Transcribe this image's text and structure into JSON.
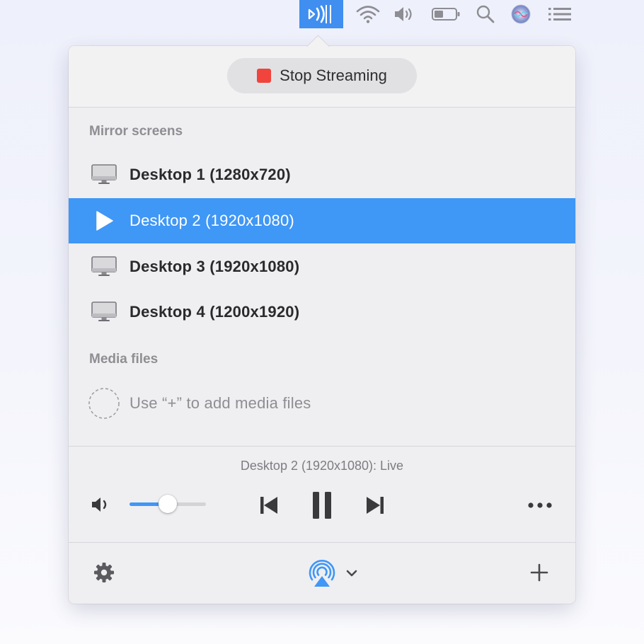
{
  "menubar": {
    "icons": [
      "airplay-stream-icon",
      "wifi-icon",
      "volume-icon",
      "battery-icon",
      "search-icon",
      "siri-icon",
      "list-icon"
    ],
    "active_color": "#3f8ef0"
  },
  "popover": {
    "stop_button": {
      "label": "Stop Streaming",
      "icon": "stop-square-icon",
      "icon_color": "#f0443c"
    },
    "mirror_section": {
      "title": "Mirror screens",
      "items": [
        {
          "label": "Desktop 1 (1280x720)",
          "icon": "monitor-icon",
          "selected": false
        },
        {
          "label": "Desktop 2 (1920x1080)",
          "icon": "play-icon",
          "selected": true
        },
        {
          "label": "Desktop 3 (1920x1080)",
          "icon": "monitor-icon",
          "selected": false
        },
        {
          "label": "Desktop 4 (1200x1920)",
          "icon": "monitor-icon",
          "selected": false
        }
      ]
    },
    "media_section": {
      "title": "Media files",
      "hint": "Use “+” to add media files",
      "hint_icon": "dashed-circle-icon"
    },
    "player": {
      "now_playing": "Desktop 2 (1920x1080): Live",
      "volume_fraction": 0.5,
      "controls": [
        "previous-track-icon",
        "pause-icon",
        "next-track-icon",
        "more-icon"
      ]
    },
    "footer": {
      "icons": [
        "gear-icon",
        "airplay-icon",
        "chevron-down-icon",
        "plus-icon"
      ],
      "accent_color": "#3f97f6"
    },
    "selection_color": "#3f97f6"
  }
}
